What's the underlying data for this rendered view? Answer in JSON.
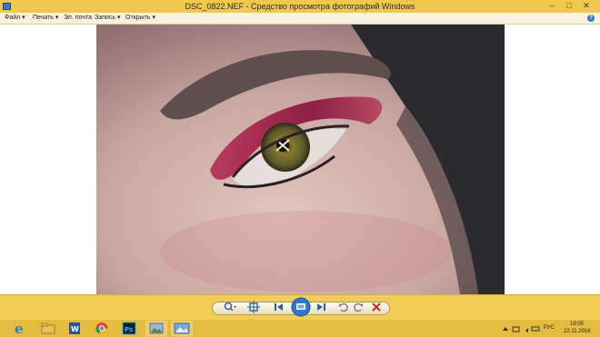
{
  "window": {
    "title": "DSC_0822.NEF - Средство просмотра фотографий Windows",
    "minimize": "–",
    "maximize": "□",
    "close": "✕"
  },
  "menu": {
    "file": "Файл",
    "print": "Печать",
    "email": "Эл. почта",
    "burn": "Запись",
    "open": "Открыть",
    "help": "?"
  },
  "taskbar": {
    "language": "РУС",
    "time": "19:05",
    "date": "22.11.2016"
  },
  "colors": {
    "titlebar": "#f0c94a",
    "controlbar": "#f1cd58",
    "taskbar": "#e3bc3e",
    "delete_red": "#d0281e"
  },
  "icons": [
    "app-icon",
    "zoom-icon",
    "fit-window-icon",
    "previous-icon",
    "slideshow-icon",
    "next-icon",
    "rotate-left-icon",
    "rotate-right-icon",
    "delete-icon",
    "ie-icon",
    "explorer-icon",
    "word-icon",
    "chrome-icon",
    "photoshop-icon",
    "photo-viewer-icon",
    "gallery-icon"
  ]
}
